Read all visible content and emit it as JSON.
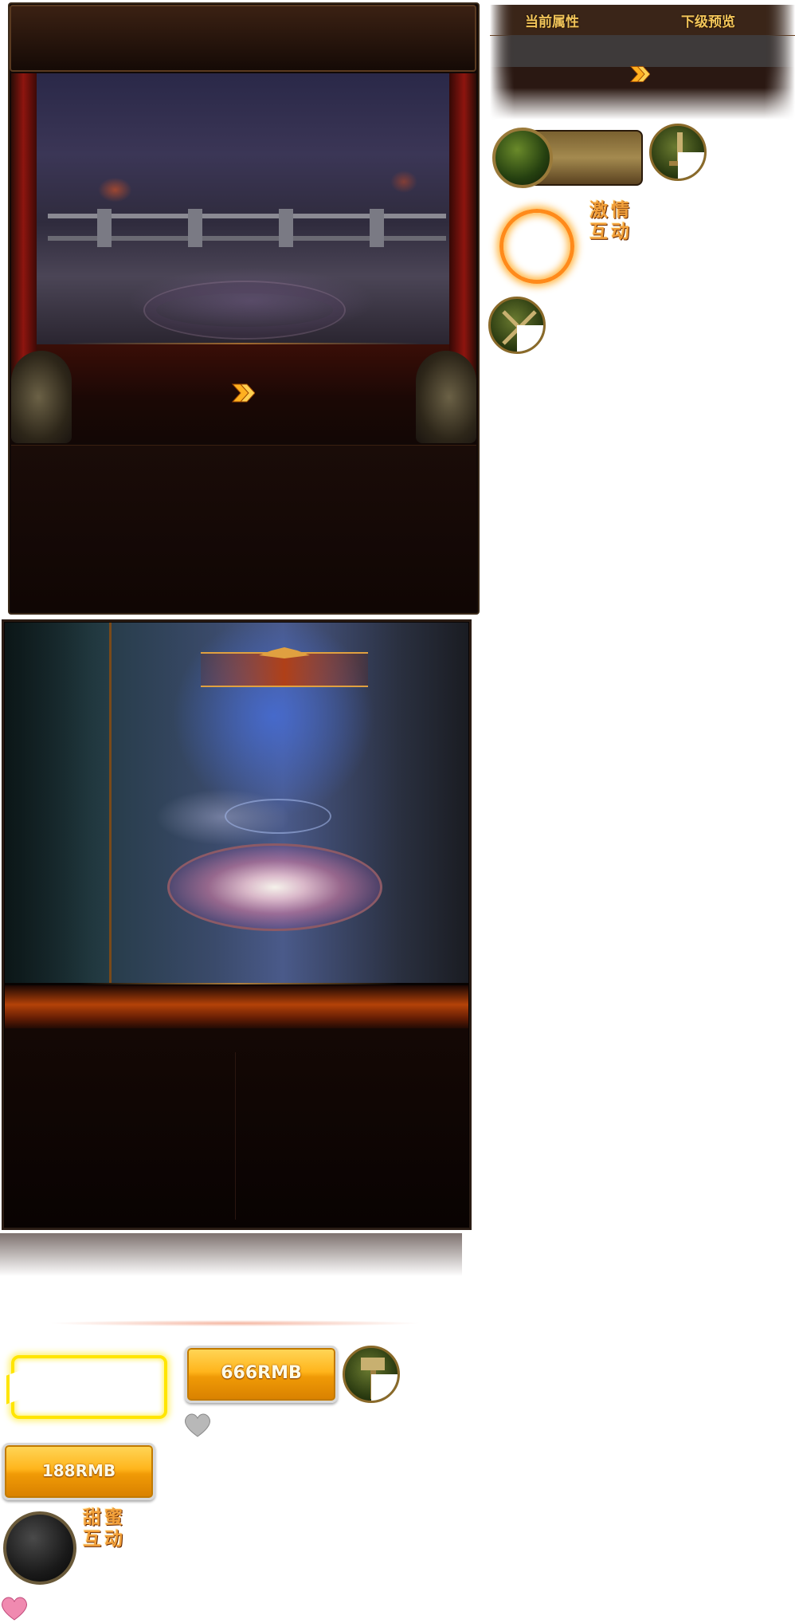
{
  "attribute_panel": {
    "current_label": "当前属性",
    "next_label": "下级预览"
  },
  "interaction_badges": {
    "passion_line1": "激情",
    "passion_line2": "互动",
    "sweet_line1": "甜蜜",
    "sweet_line2": "互动"
  },
  "purchase_buttons": {
    "button_666": "666RMB",
    "button_188": "188RMB"
  },
  "icons": {
    "panel1_arrow": "double-chevron-right-icon",
    "attr_arrow": "double-chevron-right-icon",
    "sword": "sword-icon",
    "crossed_weapons": "crossed-weapons-icon",
    "hammer": "hammer-icon",
    "heart_grey": "heart-icon",
    "heart_pink": "heart-icon"
  },
  "colors": {
    "gold_text": "#f2c55a",
    "orange_ring": "#ff8a1a",
    "button_gold": "#ffb51c",
    "frame_yellow": "#ffe500",
    "panel_dark": "#110806"
  }
}
